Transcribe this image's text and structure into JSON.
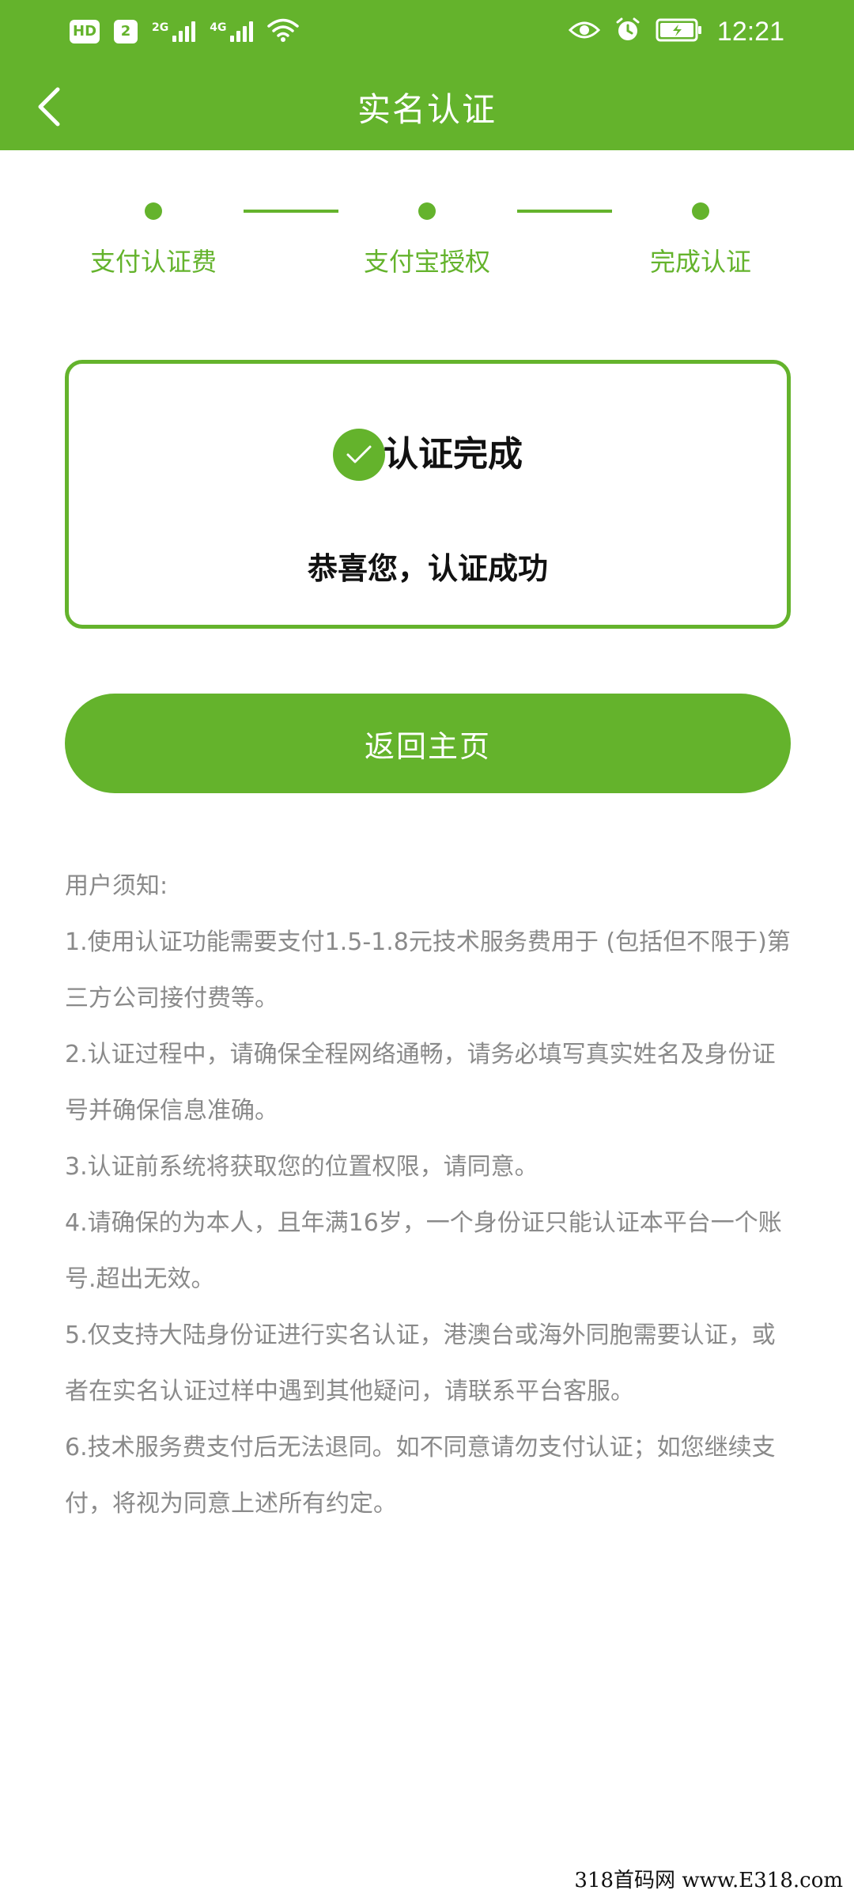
{
  "status_bar": {
    "hd_label": "HD",
    "sim_label": "2",
    "net1_label": "2G",
    "net2_label": "4G",
    "time": "12:21",
    "icons": [
      "eye-icon",
      "alarm-icon",
      "battery-charging-icon",
      "wifi-icon"
    ]
  },
  "header": {
    "title": "实名认证",
    "back_icon": "chevron-left-icon",
    "color": "#64b32c"
  },
  "steps": [
    {
      "label": "支付认证费"
    },
    {
      "label": "支付宝授权"
    },
    {
      "label": "完成认证"
    }
  ],
  "result": {
    "title": "认证完成",
    "subtitle": "恭喜您，认证成功",
    "icon": "check-circle-icon"
  },
  "home_button": {
    "label": "返回主页"
  },
  "notice": {
    "heading": "用户须知:",
    "items": [
      "1.使用认证功能需要支付1.5-1.8元技术服务费用于 (包括但不限于)第三方公司接付费等。",
      "2.认证过程中，请确保全程网络通畅，请务必填写真实姓名及身份证号并确保信息准确。",
      "3.认证前系统将获取您的位置权限，请同意。",
      "4.请确保的为本人，且年满16岁，一个身份证只能认证本平台一个账号.超出无效。",
      "5.仅支持大陆身份证进行实名认证，港澳台或海外同胞需要认证，或者在实名认证过样中遇到其他疑问，请联系平台客服。",
      "6.技术服务费支付后无法退同。如不同意请勿支付认证；如您继续支付，将视为同意上述所有约定。"
    ]
  },
  "watermark": "318首码网 www.E318.com"
}
